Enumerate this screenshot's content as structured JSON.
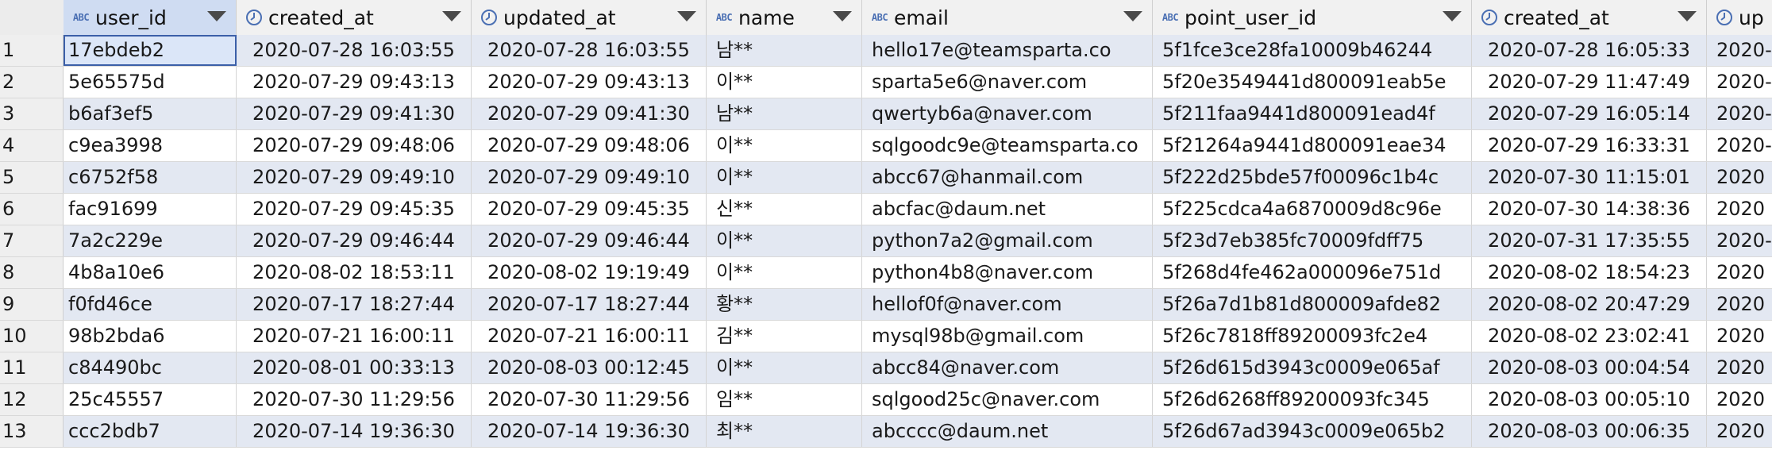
{
  "columns": [
    {
      "label": "user_id",
      "type": "text",
      "type_icon": "abc-text-icon"
    },
    {
      "label": "created_at",
      "type": "datetime",
      "type_icon": "clock-icon"
    },
    {
      "label": "updated_at",
      "type": "datetime",
      "type_icon": "clock-icon"
    },
    {
      "label": "name",
      "type": "text",
      "type_icon": "abc-text-icon"
    },
    {
      "label": "email",
      "type": "text",
      "type_icon": "abc-text-icon"
    },
    {
      "label": "point_user_id",
      "type": "text",
      "type_icon": "abc-text-icon"
    },
    {
      "label": "created_at",
      "type": "datetime",
      "type_icon": "clock-icon"
    },
    {
      "label": "up",
      "type": "datetime",
      "type_icon": "clock-icon"
    }
  ],
  "type_text_label": "ABC",
  "rows": [
    {
      "n": "1",
      "cells": [
        "17ebdeb2",
        "2020-07-28 16:03:55",
        "2020-07-28 16:03:55",
        "남**",
        "hello17e@teamsparta.co",
        "5f1fce3ce28fa10009b46244",
        "2020-07-28 16:05:33",
        "2020-"
      ]
    },
    {
      "n": "2",
      "cells": [
        "5e65575d",
        "2020-07-29 09:43:13",
        "2020-07-29 09:43:13",
        "이**",
        "sparta5e6@naver.com",
        "5f20e3549441d800091eab5e",
        "2020-07-29 11:47:49",
        "2020-"
      ]
    },
    {
      "n": "3",
      "cells": [
        "b6af3ef5",
        "2020-07-29 09:41:30",
        "2020-07-29 09:41:30",
        "남**",
        "qwertyb6a@naver.com",
        "5f211faa9441d800091ead4f",
        "2020-07-29 16:05:14",
        "2020-"
      ]
    },
    {
      "n": "4",
      "cells": [
        "c9ea3998",
        "2020-07-29 09:48:06",
        "2020-07-29 09:48:06",
        "이**",
        "sqlgoodc9e@teamsparta.co",
        "5f21264a9441d800091eae34",
        "2020-07-29 16:33:31",
        "2020-"
      ]
    },
    {
      "n": "5",
      "cells": [
        "c6752f58",
        "2020-07-29 09:49:10",
        "2020-07-29 09:49:10",
        "이**",
        "abcc67@hanmail.com",
        "5f222d25bde57f00096c1b4c",
        "2020-07-30 11:15:01",
        "2020"
      ]
    },
    {
      "n": "6",
      "cells": [
        "fac91699",
        "2020-07-29 09:45:35",
        "2020-07-29 09:45:35",
        "신**",
        "abcfac@daum.net",
        "5f225cdca4a6870009d8c96e",
        "2020-07-30 14:38:36",
        "2020"
      ]
    },
    {
      "n": "7",
      "cells": [
        "7a2c229e",
        "2020-07-29 09:46:44",
        "2020-07-29 09:46:44",
        "이**",
        "python7a2@gmail.com",
        "5f23d7eb385fc70009fdff75",
        "2020-07-31 17:35:55",
        "2020-"
      ]
    },
    {
      "n": "8",
      "cells": [
        "4b8a10e6",
        "2020-08-02 18:53:11",
        "2020-08-02 19:19:49",
        "이**",
        "python4b8@naver.com",
        "5f268d4fe462a000096e751d",
        "2020-08-02 18:54:23",
        "2020"
      ]
    },
    {
      "n": "9",
      "cells": [
        "f0fd46ce",
        "2020-07-17 18:27:44",
        "2020-07-17 18:27:44",
        "황**",
        "hellof0f@naver.com",
        "5f26a7d1b81d800009afde82",
        "2020-08-02 20:47:29",
        "2020"
      ]
    },
    {
      "n": "10",
      "cells": [
        "98b2bda6",
        "2020-07-21 16:00:11",
        "2020-07-21 16:00:11",
        "김**",
        "mysql98b@gmail.com",
        "5f26c7818ff89200093fc2e4",
        "2020-08-02 23:02:41",
        "2020"
      ]
    },
    {
      "n": "11",
      "cells": [
        "c84490bc",
        "2020-08-01 00:33:13",
        "2020-08-03 00:12:45",
        "이**",
        "abcc84@naver.com",
        "5f26d615d3943c0009e065af",
        "2020-08-03 00:04:54",
        "2020"
      ]
    },
    {
      "n": "12",
      "cells": [
        "25c45557",
        "2020-07-30 11:29:56",
        "2020-07-30 11:29:56",
        "임**",
        "sqlgood25c@naver.com",
        "5f26d6268ff89200093fc345",
        "2020-08-03 00:05:10",
        "2020"
      ]
    },
    {
      "n": "13",
      "cells": [
        "ccc2bdb7",
        "2020-07-14 19:36:30",
        "2020-07-14 19:36:30",
        "최**",
        "abcccc@daum.net",
        "5f26d67ad3943c0009e065b2",
        "2020-08-03 00:06:35",
        "2020"
      ]
    }
  ],
  "colors": {
    "header_bg": "#f1f1f1",
    "row_alt_bg": "#e3e8f2",
    "selection_border": "#3b5fa8",
    "type_icon": "#4a6fb3"
  }
}
